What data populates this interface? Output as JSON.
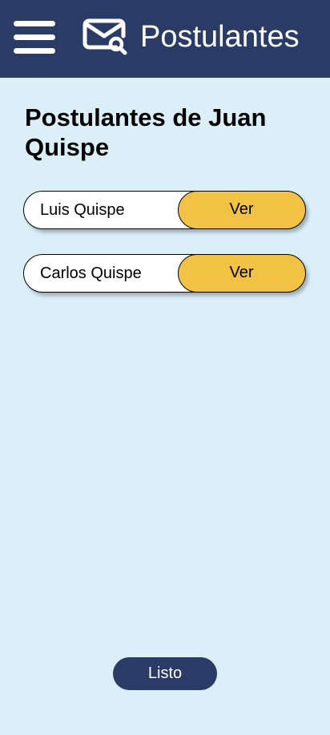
{
  "header": {
    "title": "Postulantes",
    "menu_icon": "hamburger-menu-icon",
    "app_icon": "mail-search-icon",
    "background_color": "#2a3c66"
  },
  "main": {
    "heading": "Postulantes de Juan Quispe",
    "applicants": [
      {
        "name": "Luis Quispe",
        "action_label": "Ver"
      },
      {
        "name": "Carlos Quispe",
        "action_label": "Ver"
      }
    ],
    "button_color": "#f2c244",
    "background_color": "#dbeff9"
  },
  "footer": {
    "done_label": "Listo"
  }
}
